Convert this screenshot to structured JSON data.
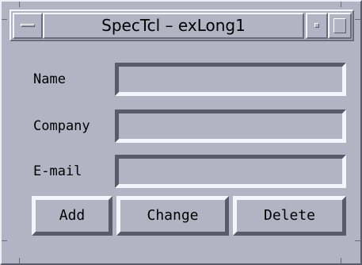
{
  "window": {
    "title": "SpecTcl – exLong1"
  },
  "form": {
    "fields": [
      {
        "label": "Name",
        "value": ""
      },
      {
        "label": "Company",
        "value": ""
      },
      {
        "label": "E-mail",
        "value": ""
      }
    ]
  },
  "buttons": {
    "add": "Add",
    "change": "Change",
    "delete": "Delete"
  },
  "icons": {
    "window_menu": "window-menu-icon",
    "minimize": "minimize-icon",
    "maximize": "maximize-icon"
  },
  "colors": {
    "background": "#b3b3c4",
    "highlight": "#f4f4fc",
    "shadow": "#5a5a6a"
  }
}
